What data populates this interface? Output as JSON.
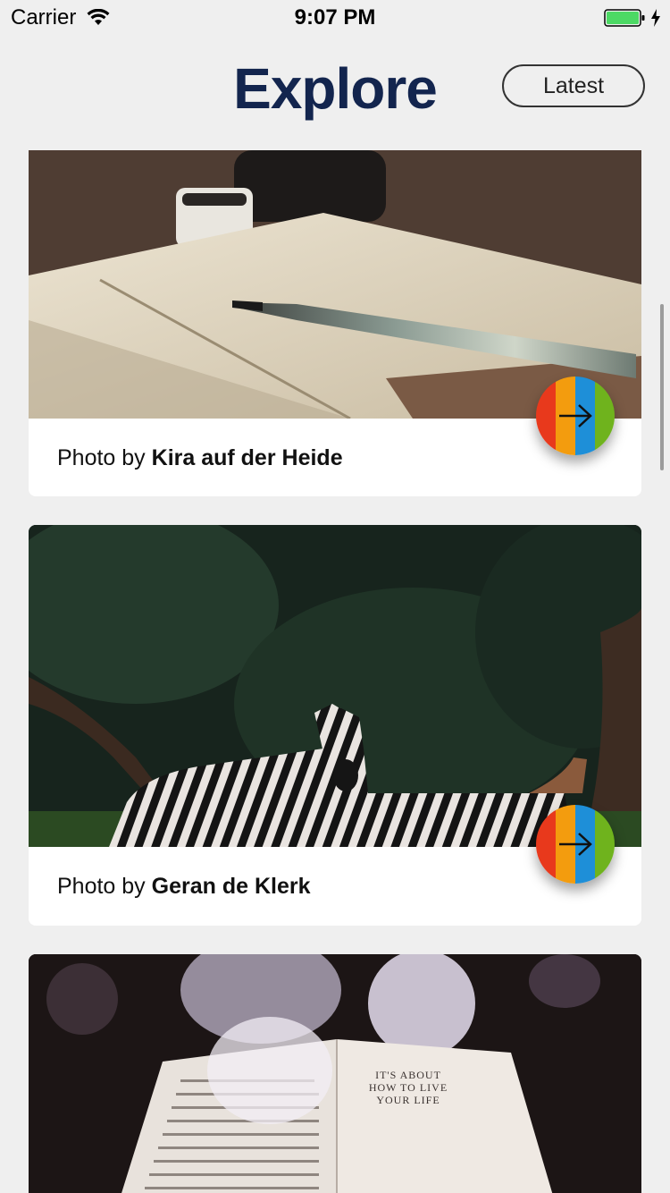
{
  "status_bar": {
    "carrier": "Carrier",
    "time": "9:07 PM",
    "battery_color": "#4cd964"
  },
  "header": {
    "title": "Explore",
    "latest_label": "Latest"
  },
  "cards": [
    {
      "caption_prefix": "Photo by ",
      "author": "Kira auf der Heide",
      "image": "pen-and-notebook-photo"
    },
    {
      "caption_prefix": "Photo by ",
      "author": "Geran de Klerk",
      "image": "zebras-photo"
    },
    {
      "caption_prefix": "",
      "author": "",
      "image": "open-book-photo",
      "book_text": "IT'S ABOUT HOW TO LIVE YOUR LIFE"
    }
  ],
  "arrow_stripes": [
    "#e8391c",
    "#f39c0e",
    "#1e8fd8",
    "#6fb31d"
  ],
  "icons": {
    "wifi": "wifi-icon",
    "battery": "battery-icon",
    "charging": "charging-icon",
    "arrow": "arrow-right-icon"
  }
}
